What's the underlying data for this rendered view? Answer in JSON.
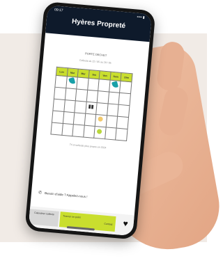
{
  "status_bar": {
    "time": "09:17",
    "indicators": "•••• ▮"
  },
  "app": {
    "title": "Hyères Propreté"
  },
  "calendar": {
    "heading": "PORTE DECHET",
    "subheading": "Collecte du 22 / 05 au 29 / 05",
    "days": [
      "Lun",
      "Mar",
      "Mer",
      "Jeu",
      "Ven",
      "Sam",
      "Dim"
    ]
  },
  "note": "Tri et collecte plus propre en 2024",
  "contact": {
    "text": "Besoin d'aide ? Appelez-nous !"
  },
  "bottom_bar": {
    "left_tab": "Calendrier collecte",
    "middle_tab_line1": "Trouver un point",
    "middle_tab_line2": "Contact"
  },
  "colors": {
    "accent": "#c9de2e",
    "header": "#0e1a2b"
  }
}
